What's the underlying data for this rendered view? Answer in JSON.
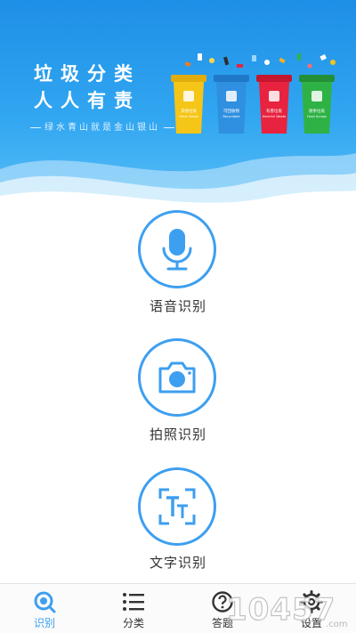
{
  "banner": {
    "slogan_line1": "垃圾分类",
    "slogan_line2": "人人有责",
    "tagline": "绿水青山就是金山银山",
    "bins": [
      {
        "cn": "其他垃圾",
        "en": "Other Waste",
        "color": "#f5c518"
      },
      {
        "cn": "可回收物",
        "en": "Recyclable",
        "color": "#2f8fe0"
      },
      {
        "cn": "有害垃圾",
        "en": "Harmful Waste",
        "color": "#e8233f"
      },
      {
        "cn": "厨余垃圾",
        "en": "Food Scraps",
        "color": "#2fb245"
      }
    ]
  },
  "features": [
    {
      "label": "语音识别",
      "icon": "microphone-icon"
    },
    {
      "label": "拍照识别",
      "icon": "camera-icon"
    },
    {
      "label": "文字识别",
      "icon": "text-scan-icon"
    }
  ],
  "tabs": [
    {
      "label": "识别",
      "icon": "search-icon",
      "active": true
    },
    {
      "label": "分类",
      "icon": "list-icon",
      "active": false
    },
    {
      "label": "答题",
      "icon": "question-icon",
      "active": false
    },
    {
      "label": "设置",
      "icon": "gear-icon",
      "active": false
    }
  ],
  "watermark": "10457",
  "watermark_suffix": ".com",
  "colors": {
    "accent": "#3d9ff0",
    "banner_top": "#1e8fe6",
    "banner_bottom": "#5bc0f7"
  }
}
